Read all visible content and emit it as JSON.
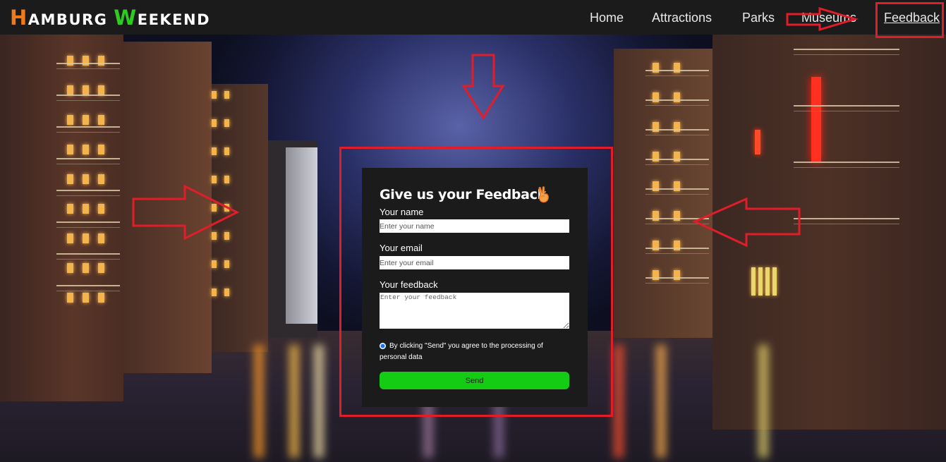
{
  "brand": {
    "letter_h": "H",
    "rest_1": "AMBURG ",
    "letter_w": "W",
    "rest_2": "EEKEND"
  },
  "nav": {
    "items": [
      {
        "label": "Home"
      },
      {
        "label": "Attractions"
      },
      {
        "label": "Parks"
      },
      {
        "label": "Museums"
      },
      {
        "label": "Feedback"
      }
    ],
    "active": "Feedback"
  },
  "form": {
    "title": "Give us your Feedback",
    "title_icon": "victory-hand-icon",
    "name_label": "Your name",
    "name_placeholder": "Enter your name",
    "email_label": "Your email",
    "email_placeholder": "Enter your email",
    "feedback_label": "Your feedback",
    "feedback_placeholder": "Enter your feedback",
    "consent_text": "By clicking \"Send\" you agree to the processing of personal data",
    "consent_checked": true,
    "send_label": "Send"
  },
  "colors": {
    "brand_h": "#f07a1a",
    "brand_w": "#2ecc1f",
    "header_bg": "#1b1b1b",
    "card_bg": "#1b1b1b",
    "send_bg": "#14cc14",
    "annotation": "#e11d2a"
  }
}
